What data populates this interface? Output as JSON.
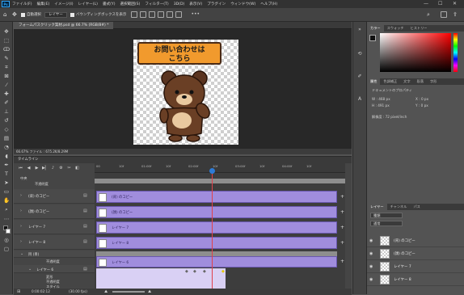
{
  "app": {
    "logo": "Ps"
  },
  "menu": [
    "ファイル(F)",
    "編集(E)",
    "イメージ(I)",
    "レイヤー(L)",
    "書式(Y)",
    "選択範囲(S)",
    "フィルター(T)",
    "3D(D)",
    "表示(V)",
    "プラグイン",
    "ウィンドウ(W)",
    "ヘルプ(H)"
  ],
  "window_controls": [
    "minimize-icon",
    "maximize-icon",
    "close-icon"
  ],
  "options": {
    "auto_select": "自動選択",
    "layer_select": "レイヤー",
    "bounding": "バウンディングボックスを表示"
  },
  "document": {
    "tab": "フォームパスクリック案材.psd @ 66.7% (RGB/8#) *",
    "status": "66.67%     ファイル : 675.2K/8.29M"
  },
  "canvas": {
    "sign_line1": "お問い合わせは",
    "sign_line2": "こちら"
  },
  "panels": {
    "color_tabs": [
      "カラー",
      "スウォッチ",
      "ヒストリー"
    ],
    "props_tabs": [
      "属性",
      "色調補正",
      "文字",
      "段落",
      "字形"
    ],
    "props_title": "ドキュメントのプロパティ",
    "w": "W : 468 px",
    "h": "H : 491 px",
    "x": "X : 0 px",
    "y": "Y : 0 px",
    "resolution": "解像度 : 72 pixel/inch",
    "layers_tabs": [
      "レイヤー",
      "チャンネル",
      "パス"
    ],
    "layers_search": "種類",
    "layer_mode": "通常",
    "layers": [
      "(背) のコピー",
      "(顔) のコピー",
      "レイヤー 7",
      "レイヤー 8"
    ]
  },
  "timeline": {
    "title": "タイムライン",
    "ruler": [
      "00",
      "10f",
      "01:00f",
      "10f",
      "02:00f",
      "10f",
      "03:00f",
      "10f",
      "04:00f",
      "10f"
    ],
    "rows": [
      "中央",
      "不透明度",
      "(背) のコピー",
      "(顔) のコピー",
      "レイヤー 7",
      "レイヤー 8",
      "目 (目)",
      "不透明度",
      "レイヤー 6",
      "変形",
      "不透明度",
      "スタイル"
    ],
    "clips": [
      "(背) のコピー",
      "(顔) のコピー",
      "レイヤー 7",
      "レイヤー 8",
      "レイヤー 6"
    ],
    "timecode": "0:00:02:12",
    "fps": "(30.00 fps)"
  }
}
